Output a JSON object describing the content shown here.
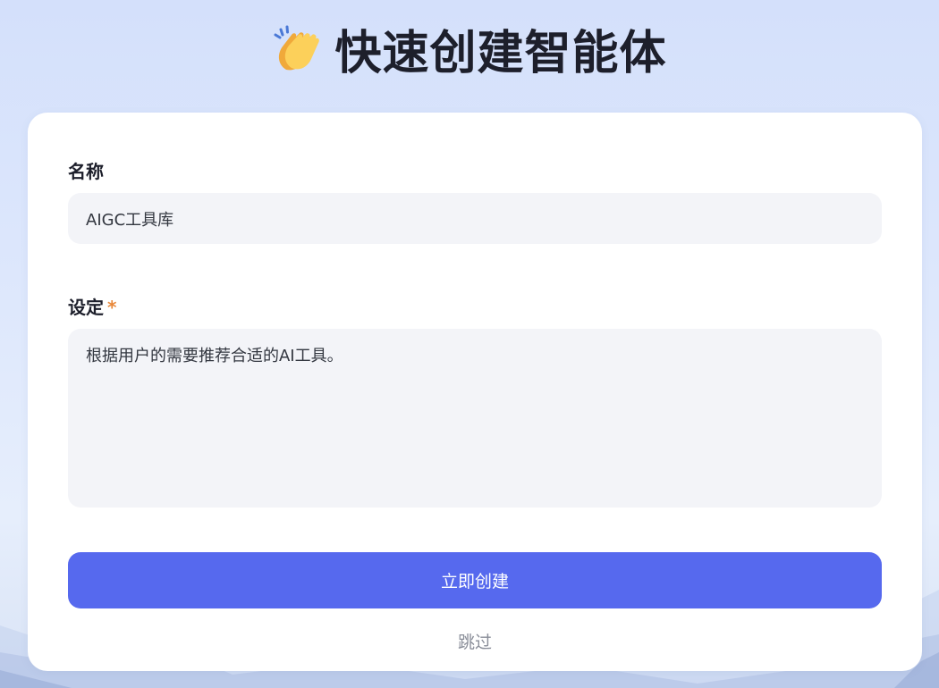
{
  "header": {
    "title": "快速创建智能体",
    "icon": "clapping-hands-icon"
  },
  "form": {
    "name_label": "名称",
    "name_value": "AIGC工具库",
    "setting_label": "设定",
    "setting_required_mark": "*",
    "setting_value": "根据用户的需要推荐合适的AI工具。",
    "create_button": "立即创建",
    "skip_link": "跳过"
  },
  "colors": {
    "accent": "#5669ee",
    "required": "#e8883a",
    "input_bg": "#f3f4f8",
    "page_bg": "#d9e4fb"
  }
}
